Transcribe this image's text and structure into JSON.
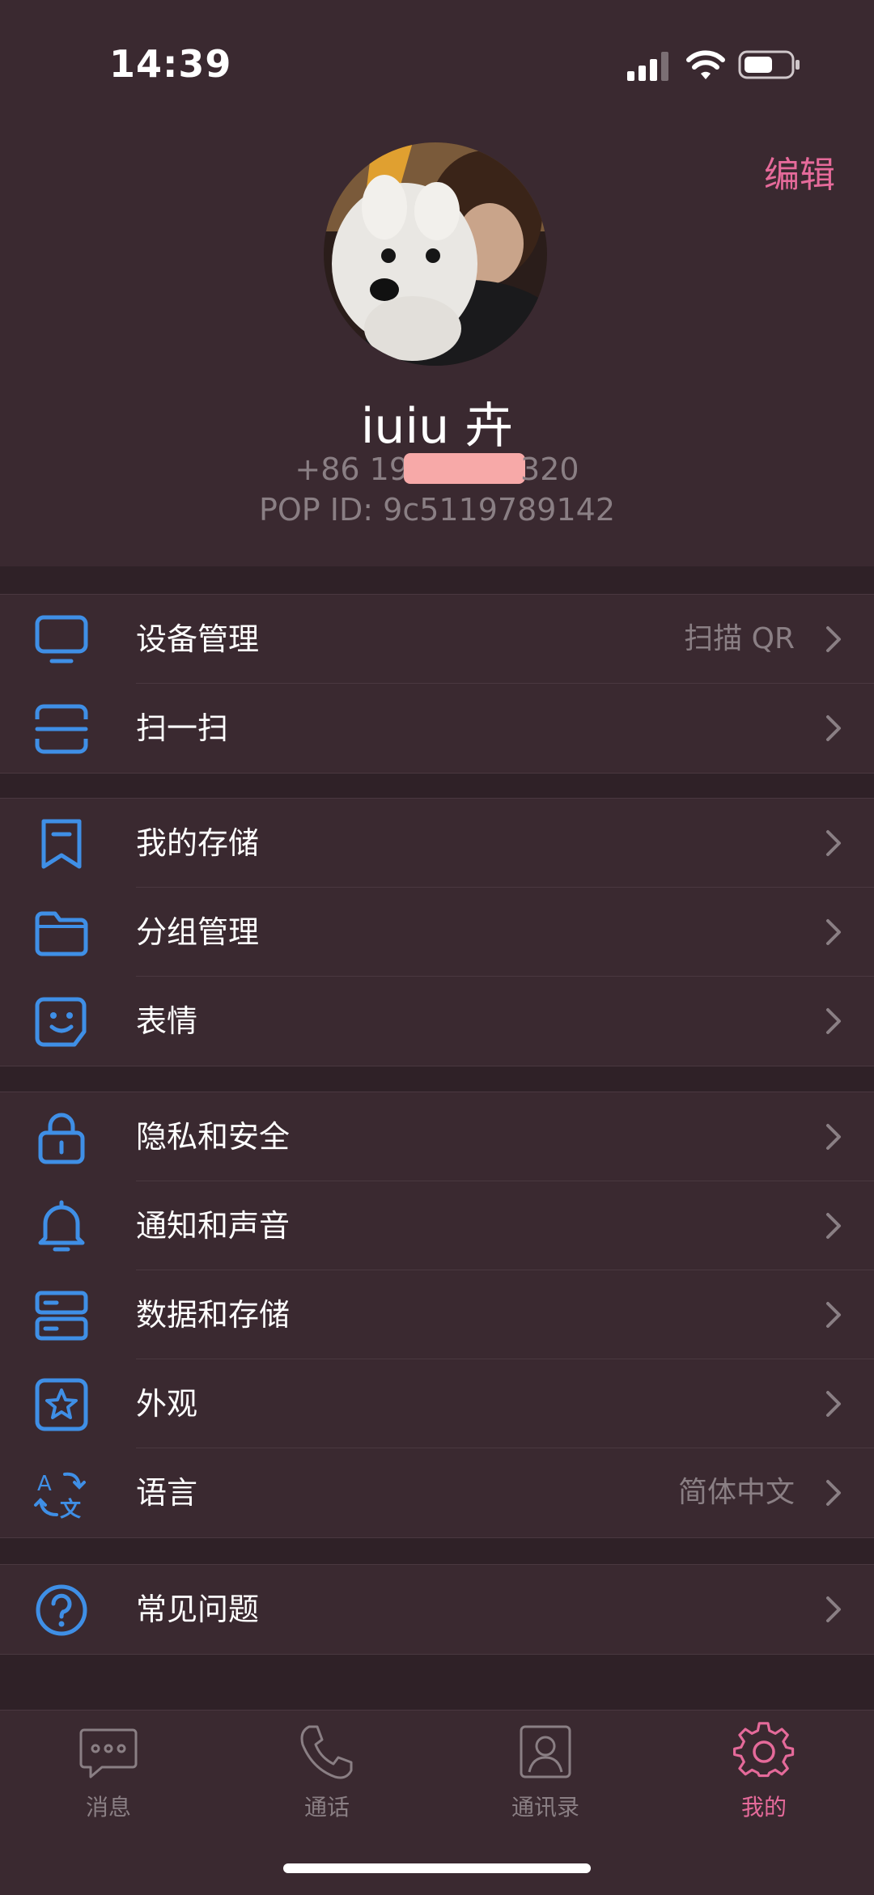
{
  "status_bar": {
    "time": "14:39"
  },
  "profile": {
    "edit_label": "编辑",
    "name": "iuiu 卉",
    "phone_prefix": "+86 19",
    "phone_suffix": "320",
    "pop_id": "POP ID: 9c5119789142"
  },
  "groups": [
    {
      "items": [
        {
          "icon": "monitor-icon",
          "label": "设备管理",
          "value": "扫描 QR"
        },
        {
          "icon": "scan-icon",
          "label": "扫一扫",
          "value": ""
        }
      ]
    },
    {
      "items": [
        {
          "icon": "bookmark-icon",
          "label": "我的存储",
          "value": ""
        },
        {
          "icon": "folder-icon",
          "label": "分组管理",
          "value": ""
        },
        {
          "icon": "sticker-icon",
          "label": "表情",
          "value": ""
        }
      ]
    },
    {
      "items": [
        {
          "icon": "lock-icon",
          "label": "隐私和安全",
          "value": ""
        },
        {
          "icon": "bell-icon",
          "label": "通知和声音",
          "value": ""
        },
        {
          "icon": "server-icon",
          "label": "数据和存储",
          "value": ""
        },
        {
          "icon": "star-icon",
          "label": "外观",
          "value": ""
        },
        {
          "icon": "translate-icon",
          "label": "语言",
          "value": "简体中文"
        }
      ]
    },
    {
      "items": [
        {
          "icon": "help-icon",
          "label": "常见问题",
          "value": ""
        }
      ]
    }
  ],
  "tabs": [
    {
      "icon": "chat-icon",
      "label": "消息",
      "active": false
    },
    {
      "icon": "phone-icon",
      "label": "通话",
      "active": false
    },
    {
      "icon": "contacts-icon",
      "label": "通讯录",
      "active": false
    },
    {
      "icon": "settings-icon",
      "label": "我的",
      "active": true
    }
  ],
  "colors": {
    "accent": "#e56a9a",
    "icon_blue": "#3f8fe6",
    "background": "#3a2930",
    "divider": "#2f2127"
  }
}
